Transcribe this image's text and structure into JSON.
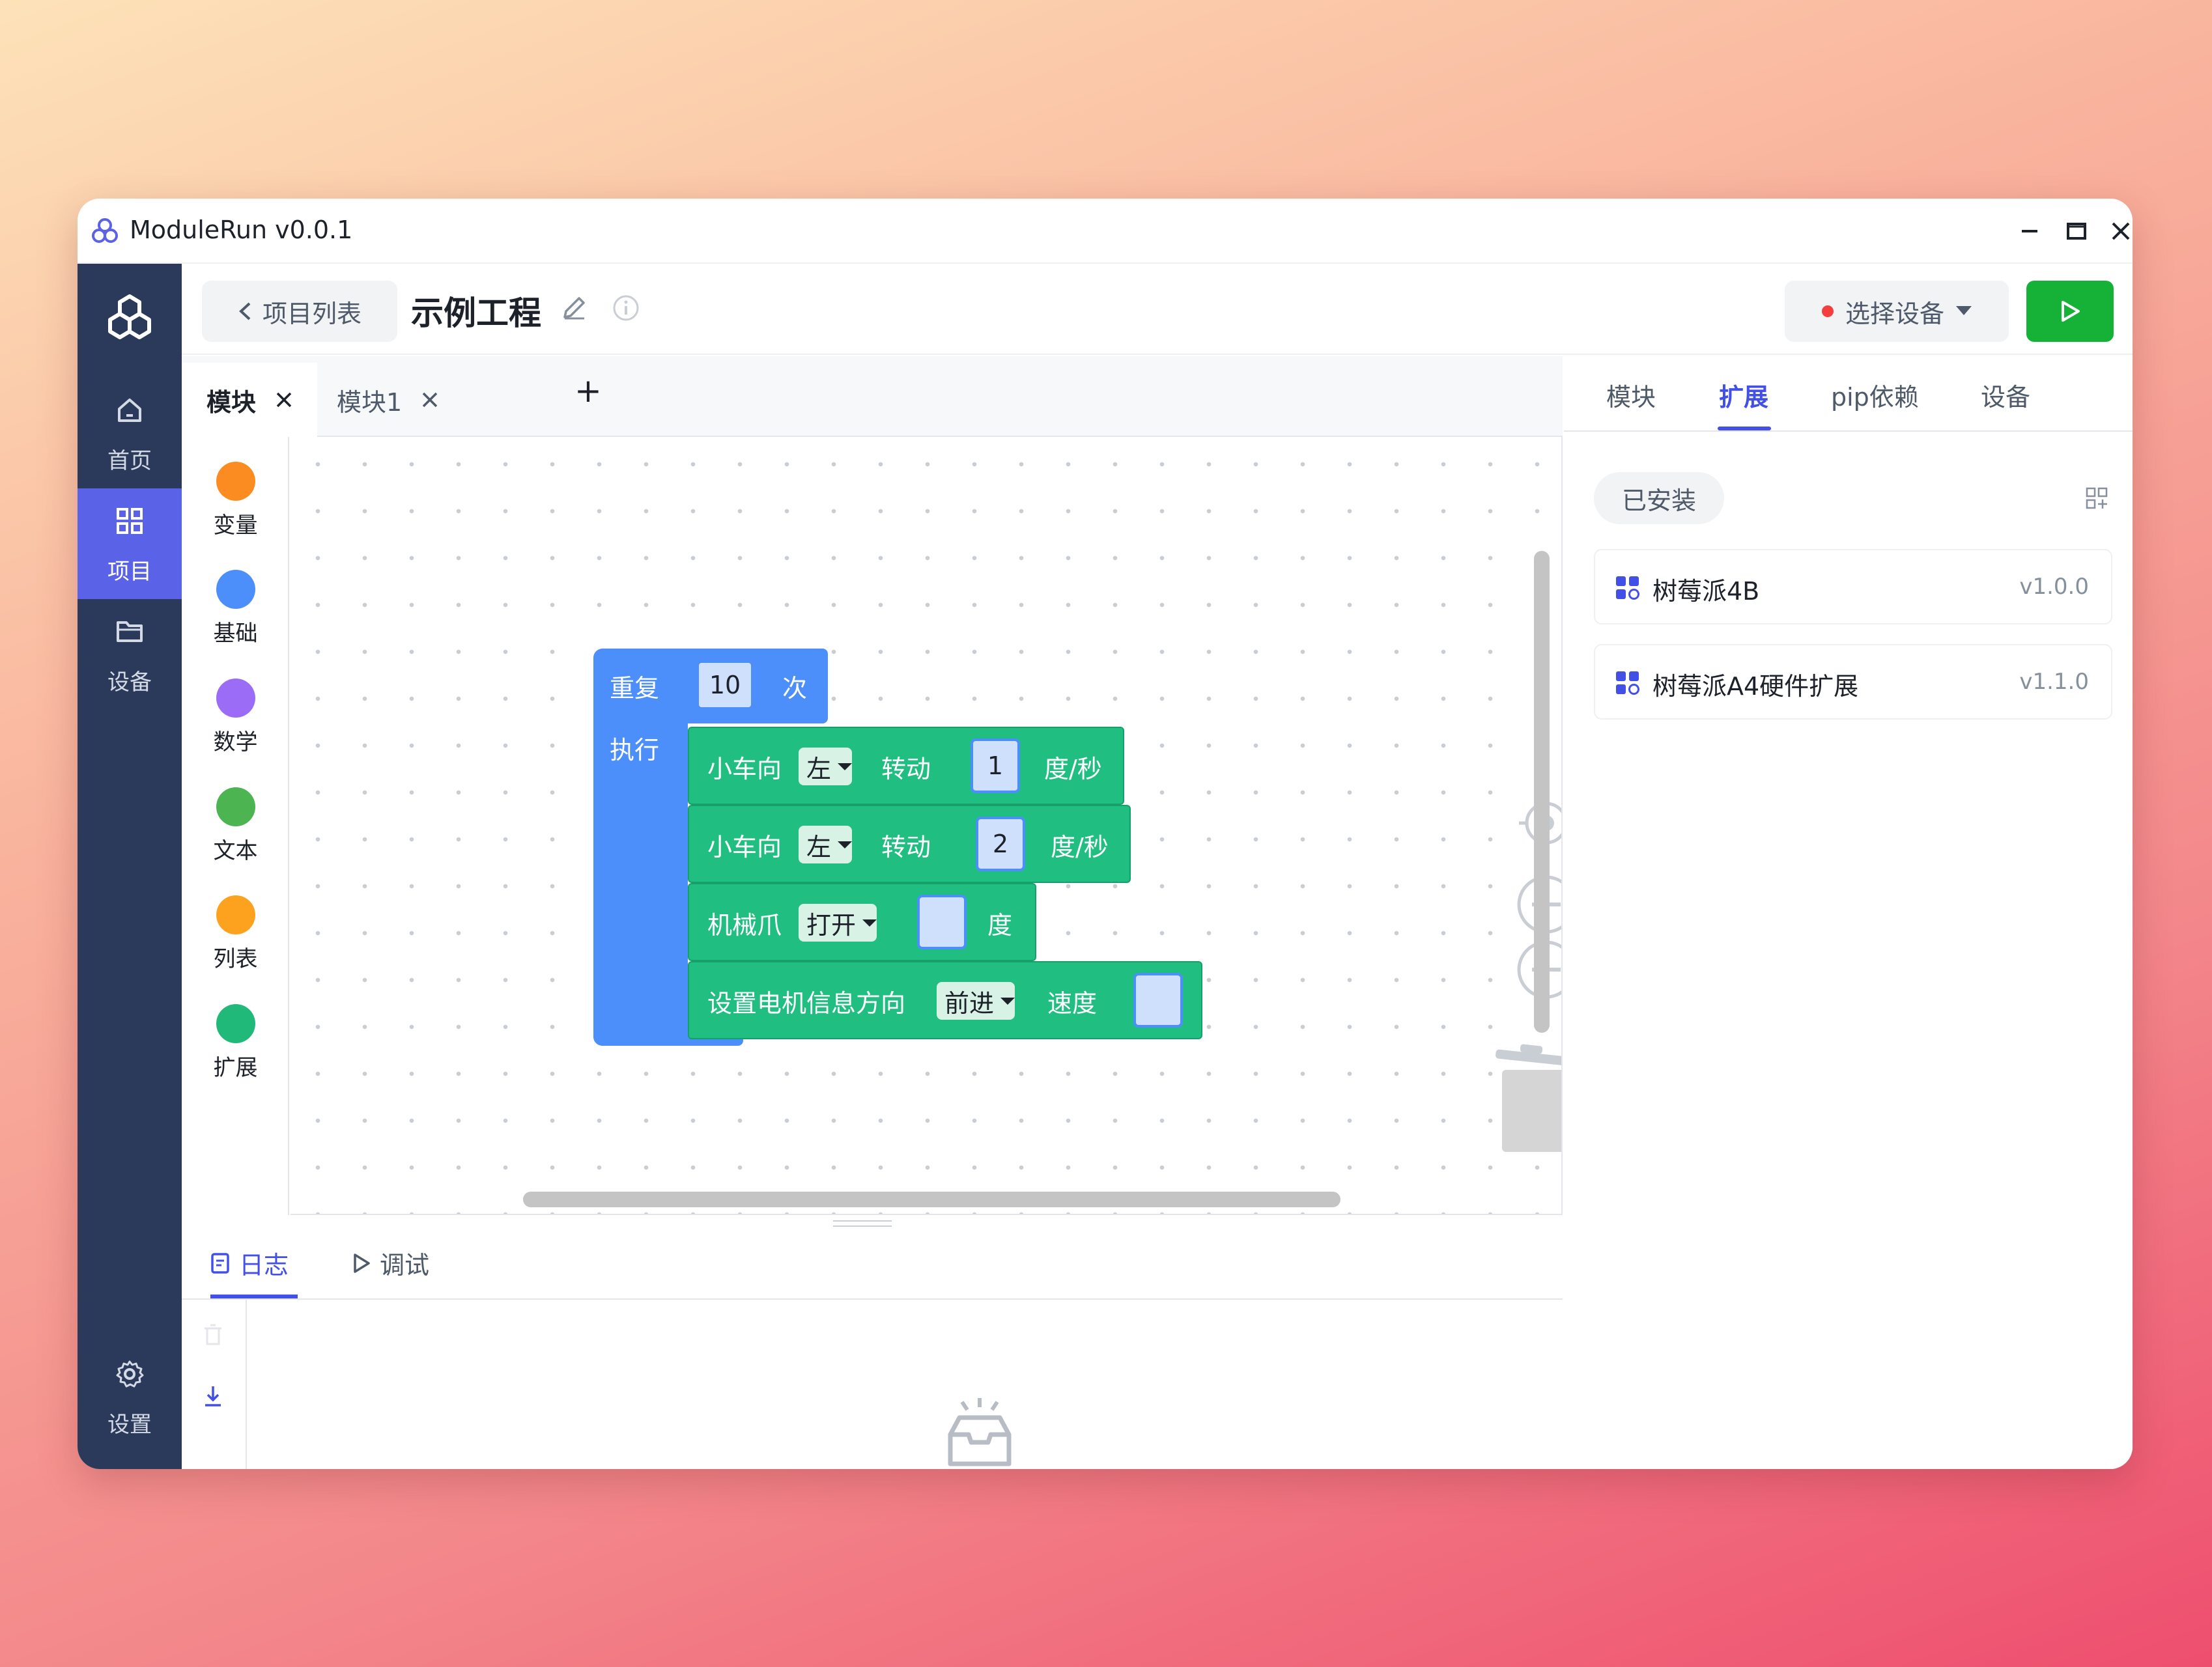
{
  "window": {
    "title": "ModuleRun v0.0.1"
  },
  "nav": {
    "items": [
      {
        "label": "首页",
        "icon": "home-icon"
      },
      {
        "label": "项目",
        "icon": "grid-icon"
      },
      {
        "label": "设备",
        "icon": "folder-icon"
      }
    ],
    "settings_label": "设置"
  },
  "header": {
    "back_label": "项目列表",
    "project_title": "示例工程",
    "device_select_label": "选择设备"
  },
  "editor": {
    "tabs": [
      {
        "label": "模块",
        "active": true
      },
      {
        "label": "模块1",
        "active": false
      }
    ],
    "add_tab": "+"
  },
  "toolbox": {
    "categories": [
      {
        "label": "变量",
        "color": "#fb8c21"
      },
      {
        "label": "基础",
        "color": "#4c8ffb"
      },
      {
        "label": "数学",
        "color": "#9b6cf5"
      },
      {
        "label": "文本",
        "color": "#4cb451"
      },
      {
        "label": "列表",
        "color": "#fda21f"
      },
      {
        "label": "扩展",
        "color": "#20b97a"
      }
    ]
  },
  "blocks": {
    "repeat": {
      "label": "重复",
      "count": "10",
      "suffix": "次",
      "do_label": "执行"
    },
    "turn1": {
      "prefix": "小车向",
      "direction": "左",
      "action": "转动",
      "value": "1",
      "unit": "度/秒"
    },
    "turn2": {
      "prefix": "小车向",
      "direction": "左",
      "action": "转动",
      "value": "2",
      "unit": "度/秒"
    },
    "claw": {
      "prefix": "机械爪",
      "state": "打开",
      "unit": "度"
    },
    "motor": {
      "prefix": "设置电机信息方向",
      "direction": "前进",
      "speed_label": "速度"
    }
  },
  "right_panel": {
    "tabs": [
      "模块",
      "扩展",
      "pip依赖",
      "设备"
    ],
    "active_tab": "扩展",
    "installed_label": "已安装",
    "extensions": [
      {
        "name": "树莓派4B",
        "version": "v1.0.0"
      },
      {
        "name": "树莓派A4硬件扩展",
        "version": "v1.1.0"
      }
    ]
  },
  "log_panel": {
    "tabs": [
      {
        "label": "日志",
        "active": true
      },
      {
        "label": "调试",
        "active": false
      }
    ]
  },
  "colors": {
    "accent": "#4350e8",
    "nav_bg": "#2b3a5a",
    "nav_active": "#5a62e8",
    "run": "#16b137",
    "block_blue": "#4c8ffb",
    "block_green": "#20bf81"
  }
}
